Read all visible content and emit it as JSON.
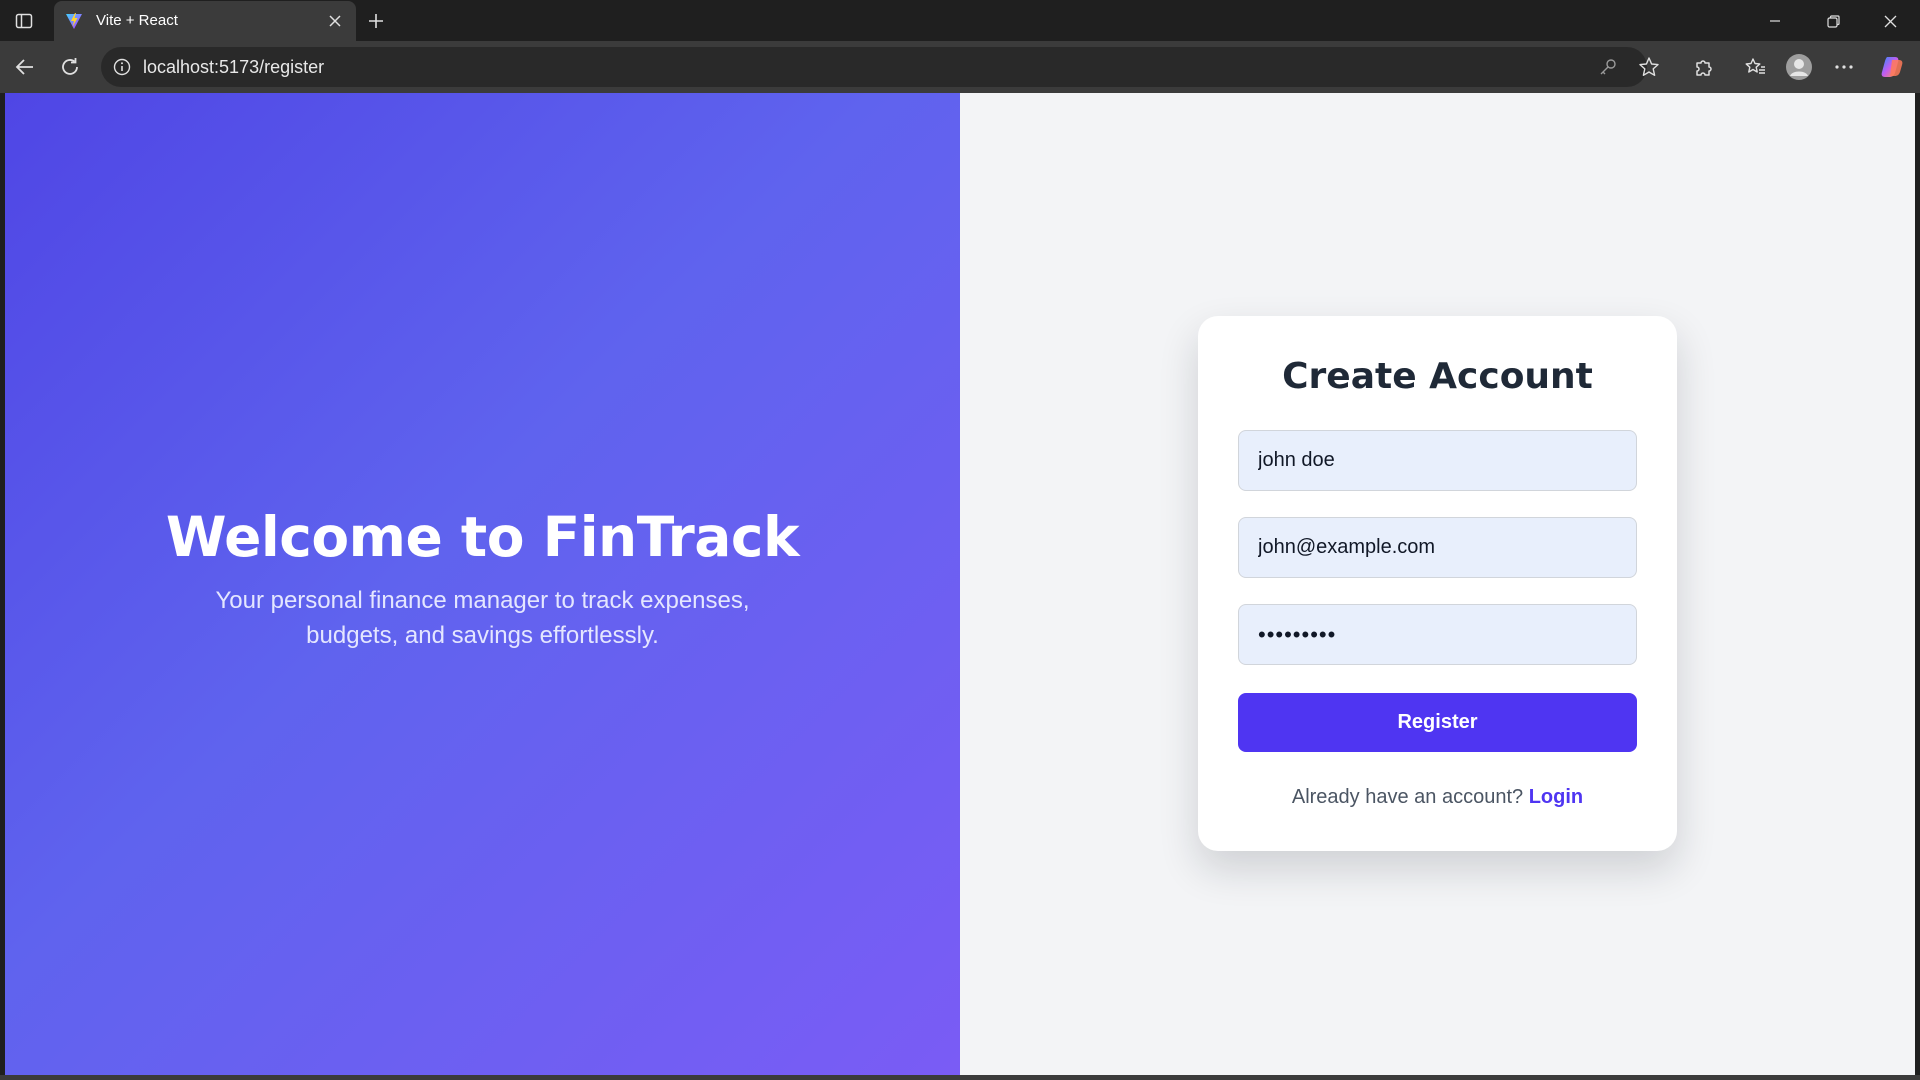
{
  "browser": {
    "tab_title": "Vite + React",
    "url": "localhost:5173/register",
    "icons": {
      "sidebar": "sidebar-toggle-icon",
      "favicon": "vite-logo-icon",
      "tab_close": "close-icon",
      "new_tab": "plus-icon",
      "back": "back-arrow-icon",
      "reload": "reload-icon",
      "site_info": "info-icon",
      "password": "key-icon",
      "favorite": "star-icon",
      "extensions": "puzzle-icon",
      "favorites": "favorites-icon",
      "profile": "profile-avatar-icon",
      "more": "ellipsis-icon",
      "copilot": "copilot-icon"
    }
  },
  "hero": {
    "title": "Welcome to FinTrack",
    "subtitle": "Your personal finance manager to track expenses, budgets, and savings effortlessly."
  },
  "form": {
    "title": "Create Account",
    "name_value": "john doe",
    "email_value": "john@example.com",
    "password_value": "•••••••••",
    "submit_label": "Register",
    "switch_prompt": "Already have an account?",
    "switch_link": "Login"
  },
  "colors": {
    "accent": "#4f35f2",
    "hero_gradient_start": "#4f46e5",
    "hero_gradient_end": "#7a5cf5",
    "form_background": "#f3f4f6",
    "input_fill": "#e8effc"
  }
}
